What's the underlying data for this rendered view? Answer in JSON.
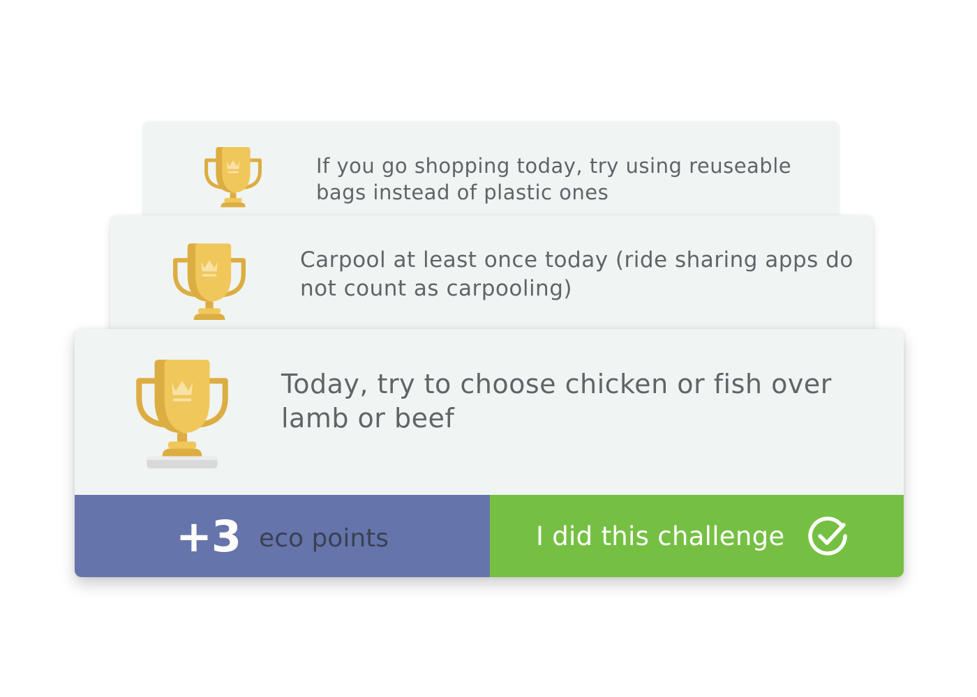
{
  "challenges": [
    {
      "text": "If you go shopping today, try using reuseable bags instead of plastic ones",
      "icon": "trophy-icon"
    },
    {
      "text": "Carpool at least once today (ride sharing apps do not count as carpooling)",
      "icon": "trophy-icon"
    },
    {
      "text": "Today, try to choose chicken or fish over lamb or beef",
      "icon": "trophy-icon"
    }
  ],
  "reward": {
    "points": "+3",
    "label": "eco points"
  },
  "action": {
    "label": "I did this challenge",
    "icon": "check-circle-icon"
  },
  "colors": {
    "card_bg": "#f0f5f3",
    "text": "#5f6468",
    "points_panel": "#6674ac",
    "action_button": "#75c043",
    "trophy_gold": "#f0c75a",
    "trophy_shade": "#dcad42"
  }
}
